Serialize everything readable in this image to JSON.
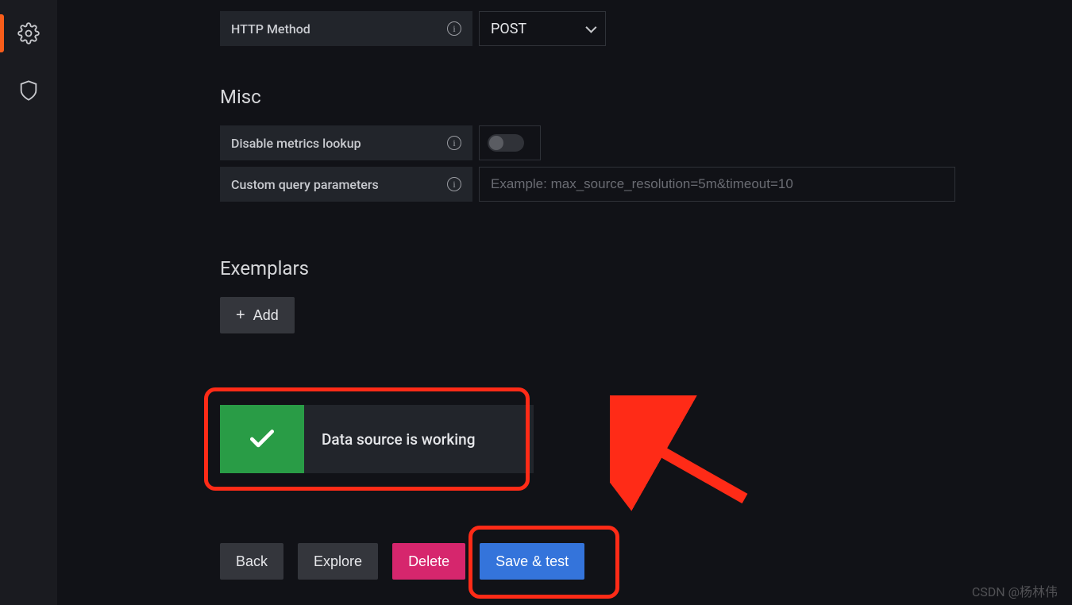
{
  "sidebar": {
    "items": [
      {
        "name": "settings-icon",
        "active": true
      },
      {
        "name": "shield-icon",
        "active": false
      }
    ]
  },
  "form": {
    "http_method": {
      "label": "HTTP Method",
      "value": "POST"
    },
    "misc_heading": "Misc",
    "disable_metrics_lookup": {
      "label": "Disable metrics lookup",
      "checked": false
    },
    "custom_query_params": {
      "label": "Custom query parameters",
      "placeholder": "Example: max_source_resolution=5m&timeout=10",
      "value": ""
    },
    "exemplars_heading": "Exemplars",
    "add_button": "Add"
  },
  "alert": {
    "status": "success",
    "message": "Data source is working"
  },
  "buttons": {
    "back": "Back",
    "explore": "Explore",
    "delete": "Delete",
    "save_test": "Save & test"
  },
  "watermark": "CSDN @杨林伟"
}
